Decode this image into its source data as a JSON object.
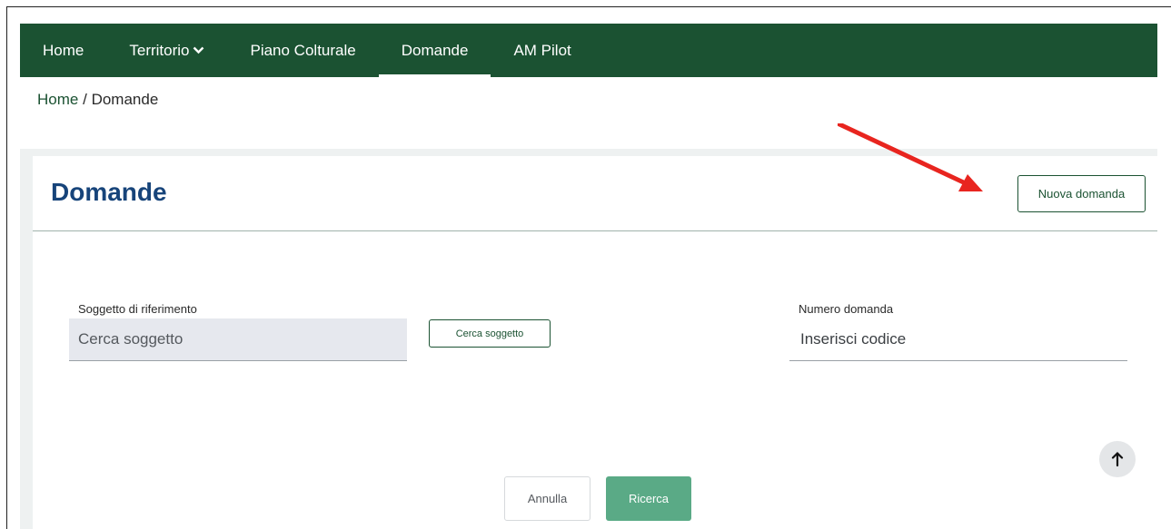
{
  "nav": {
    "items": [
      {
        "label": "Home"
      },
      {
        "label": "Territorio"
      },
      {
        "label": "Piano Colturale"
      },
      {
        "label": "Domande"
      },
      {
        "label": "AM Pilot"
      }
    ],
    "active": "Domande"
  },
  "breadcrumb": {
    "home": "Home",
    "separator": "/",
    "current": "Domande"
  },
  "page": {
    "title": "Domande",
    "new_button": "Nuova domanda"
  },
  "form": {
    "subject": {
      "label": "Soggetto di riferimento",
      "placeholder": "Cerca soggetto",
      "search_button": "Cerca soggetto"
    },
    "number": {
      "label": "Numero domanda",
      "placeholder": "Inserisci codice"
    },
    "cancel_button": "Annulla",
    "search_button": "Ricerca"
  },
  "icons": {
    "dropdown": "chevron-down-icon",
    "scroll_top": "arrow-up-icon",
    "annotation": "red-arrow-annotation"
  },
  "colors": {
    "navbar": "#1b5232",
    "title": "#17447a",
    "primary_button": "#5aaa86",
    "annotation_arrow": "#e8251f"
  }
}
